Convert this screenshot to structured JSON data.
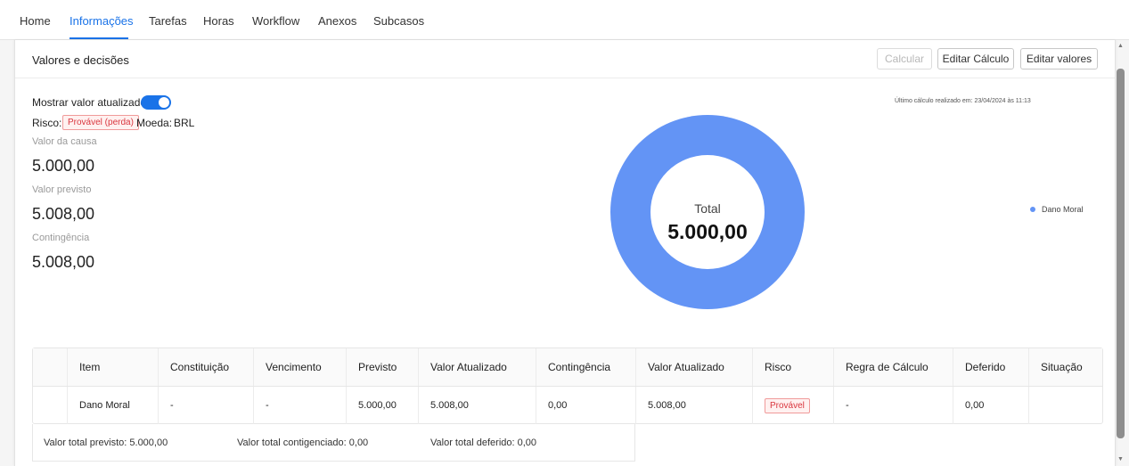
{
  "nav": {
    "tabs": [
      "Home",
      "Informações",
      "Tarefas",
      "Horas",
      "Workflow",
      "Anexos",
      "Subcasos"
    ],
    "active": "Informações"
  },
  "card": {
    "title": "Valores e decisões",
    "buttons": {
      "calcular": "Calcular",
      "editar_calculo": "Editar Cálculo",
      "editar_valores": "Editar valores"
    }
  },
  "summary": {
    "show_updated_label": "Mostrar valor atualizado",
    "show_updated_on": true,
    "risk_label": "Risco:",
    "risk_value": "Provável (perda)",
    "currency_label": "Moeda:",
    "currency_value": "BRL",
    "fields": [
      {
        "label": "Valor da causa",
        "value": "5.000,00"
      },
      {
        "label": "Valor previsto",
        "value": "5.008,00"
      },
      {
        "label": "Contingência",
        "value": "5.008,00"
      }
    ],
    "last_calc": "Último cálculo realizado em: 23/04/2024 às 11:13"
  },
  "chart_data": {
    "type": "pie",
    "center_label": "Total",
    "center_value": "5.000,00",
    "categories": [
      "Dano Moral"
    ],
    "values": [
      5000
    ],
    "colors": [
      "#6394f5"
    ],
    "legend_position": "right"
  },
  "table": {
    "headers": [
      "",
      "Item",
      "Constituição",
      "Vencimento",
      "Previsto",
      "Valor Atualizado",
      "Contingência",
      "Valor Atualizado",
      "Risco",
      "Regra de Cálculo",
      "Deferido",
      "Situação"
    ],
    "rows": [
      [
        "",
        "Dano Moral",
        "-",
        "-",
        "5.000,00",
        "5.008,00",
        "0,00",
        "5.008,00",
        "Provável",
        "-",
        "0,00",
        ""
      ]
    ]
  },
  "totals": {
    "previsto": "Valor total previsto: 5.000,00",
    "contingenciado": "Valor total contigenciado: 0,00",
    "deferido": "Valor total deferido: 0,00"
  },
  "colors": {
    "accent": "#1a73e8",
    "chart": "#6394f5",
    "risk": "#d9363e"
  }
}
